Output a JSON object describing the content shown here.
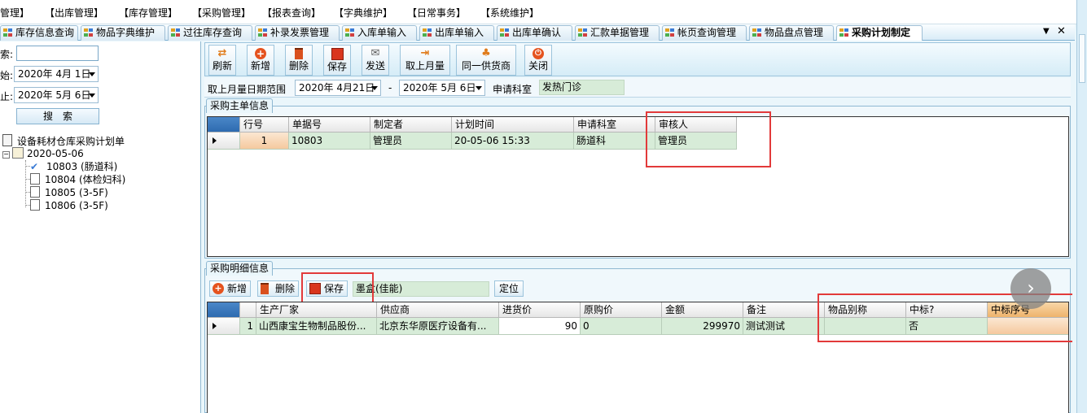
{
  "menu": [
    "管理】",
    "【出库管理】",
    "【库存管理】",
    "【采购管理】",
    "【报表查询】",
    "【字典维护】",
    "【日常事务】",
    "【系统维护】"
  ],
  "tabs": [
    "库存信息查询",
    "物品字典维护",
    "过往库存查询",
    "补录发票管理",
    "入库单输入",
    "出库单输入",
    "出库单确认",
    "汇款单据管理",
    "帐页查询管理",
    "物品盘点管理",
    "采购计划制定"
  ],
  "tabstrip_controls": {
    "dropdown": "▼",
    "close": "✕"
  },
  "left": {
    "label_search": "索:",
    "label_start": "始:",
    "label_end": "止:",
    "start_date": "2020年 4月 1日",
    "end_date": "2020年 5月 6日",
    "search_button": "搜　索",
    "tree": {
      "root": "设备耗材仓库采购计划单",
      "date_node": "2020-05-06",
      "items": [
        "10803 (肠道科)",
        "10804 (体检妇科)",
        "10805 (3-5F)",
        "10806 (3-5F)"
      ]
    }
  },
  "toolbar": [
    "刷新",
    "新增",
    "删除",
    "保存",
    "发送",
    "取上月量",
    "同一供货商",
    "关闭"
  ],
  "filter": {
    "label_range": "取上月量日期范围",
    "from": "2020年 4月21日",
    "dash": "-",
    "to": "2020年 5月 6日",
    "label_dept": "申请科室",
    "dept_value": "发热门诊"
  },
  "master": {
    "title": "采购主单信息",
    "columns": [
      "行号",
      "单据号",
      "制定者",
      "计划时间",
      "申请科室",
      "审核人"
    ],
    "rows": [
      [
        "1",
        "10803",
        "管理员",
        "20-05-06 15:33",
        "肠道科",
        "管理员"
      ]
    ]
  },
  "detail": {
    "title": "采购明细信息",
    "toolbar": {
      "add": "新增",
      "delete": "删除",
      "save": "保存",
      "item_value": "墨盒(佳能)",
      "locate": "定位"
    },
    "columns": [
      "生产厂家",
      "供应商",
      "进货价",
      "原购价",
      "金额",
      "备注",
      "物品别称",
      "中标?",
      "中标序号"
    ],
    "rows": [
      [
        "1",
        "山西康宝生物制品股份...",
        "北京东华原医疗设备有...",
        "90",
        "0",
        "299970",
        "测试测试",
        "",
        "否",
        ""
      ]
    ]
  },
  "colors": {
    "accent": "#e23a3a",
    "row_bg": "#d7ecd8",
    "highlight_cell": "#f7d7b8"
  }
}
